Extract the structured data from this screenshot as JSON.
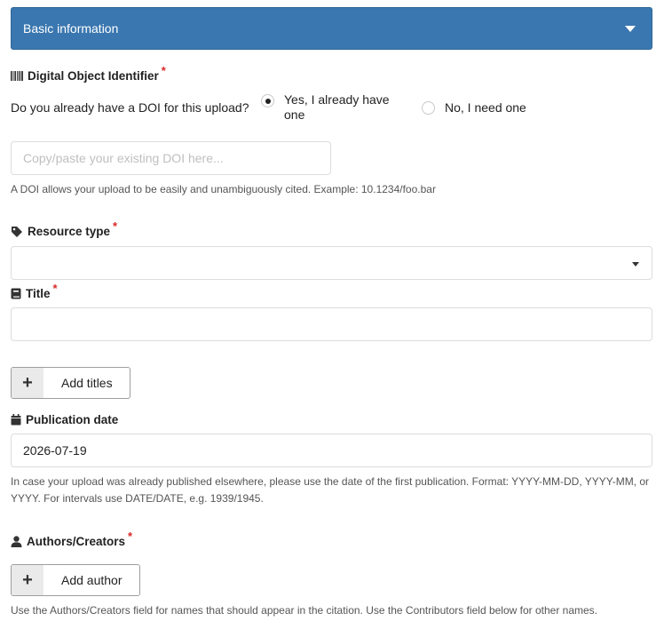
{
  "section": {
    "title": "Basic information"
  },
  "doi": {
    "label": "Digital Object Identifier",
    "required": "*",
    "question": "Do you already have a DOI for this upload?",
    "options": [
      {
        "label": "Yes, I already have one",
        "checked": true
      },
      {
        "label": "No, I need one",
        "checked": false
      }
    ],
    "placeholder": "Copy/paste your existing DOI here...",
    "value": "",
    "help": "A DOI allows your upload to be easily and unambiguously cited. Example: 10.1234/foo.bar"
  },
  "resource_type": {
    "label": "Resource type",
    "required": "*",
    "selected": ""
  },
  "title": {
    "label": "Title",
    "required": "*",
    "value": "",
    "add_button": "Add titles"
  },
  "publication_date": {
    "label": "Publication date",
    "value": "2026-07-19",
    "help": "In case your upload was already published elsewhere, please use the date of the first publication. Format: YYYY-MM-DD, YYYY-MM, or YYYY. For intervals use DATE/DATE, e.g. 1939/1945."
  },
  "authors": {
    "label": "Authors/Creators",
    "required": "*",
    "add_button": "Add author",
    "help": "Use the Authors/Creators field for names that should appear in the citation. Use the Contributors field below for other names."
  },
  "colors": {
    "header_bg": "#3a77b0",
    "required_mark": "#db2828"
  }
}
